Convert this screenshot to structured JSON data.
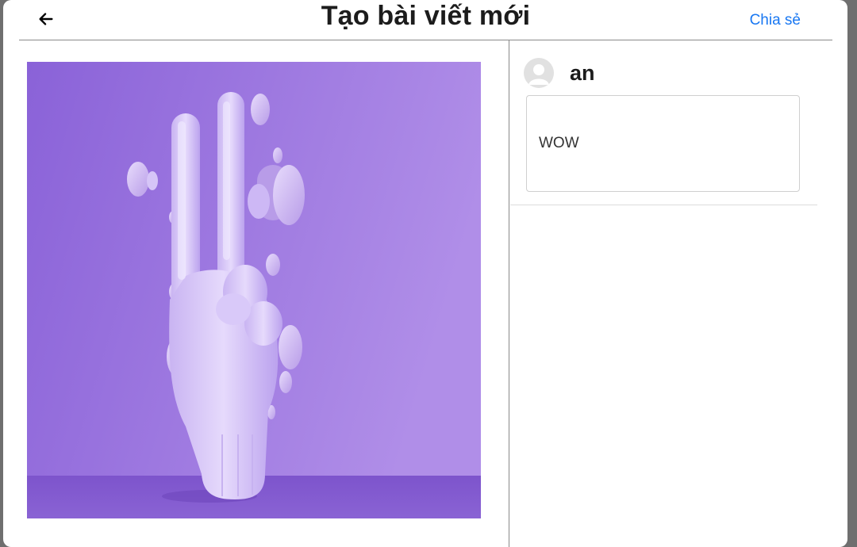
{
  "dialog": {
    "title": "Tạo bài viết mới",
    "share_label": "Chia sẻ"
  },
  "icons": {
    "back": "arrow-left-icon",
    "avatar": "user-avatar-icon"
  },
  "author": {
    "name": "an"
  },
  "caption": {
    "value": "WOW"
  },
  "colors": {
    "share_link": "#1877f2",
    "image_background": "#9a7ae0"
  }
}
